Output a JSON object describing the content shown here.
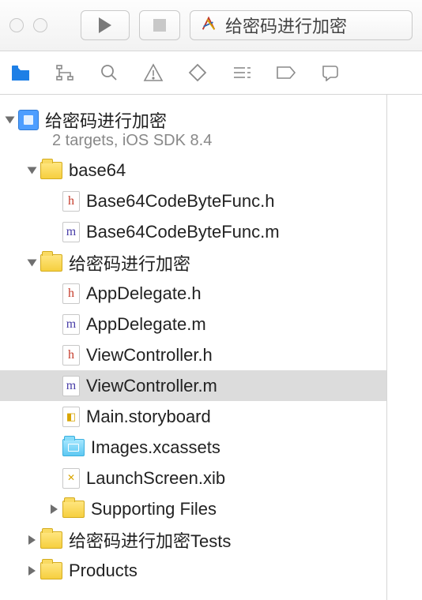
{
  "toolbar": {
    "scheme_label": "给密码进行加密"
  },
  "project": {
    "name": "给密码进行加密",
    "subtitle": "2 targets, iOS SDK 8.4"
  },
  "tree": [
    {
      "type": "folder",
      "name": "base64",
      "expanded": true,
      "depth": 1,
      "children": [
        {
          "type": "h",
          "name": "Base64CodeByteFunc.h",
          "depth": 2
        },
        {
          "type": "m",
          "name": "Base64CodeByteFunc.m",
          "depth": 2
        }
      ]
    },
    {
      "type": "folder",
      "name": "给密码进行加密",
      "expanded": true,
      "depth": 1,
      "children": [
        {
          "type": "h",
          "name": "AppDelegate.h",
          "depth": 2
        },
        {
          "type": "m",
          "name": "AppDelegate.m",
          "depth": 2
        },
        {
          "type": "h",
          "name": "ViewController.h",
          "depth": 2
        },
        {
          "type": "m",
          "name": "ViewController.m",
          "depth": 2,
          "selected": true
        },
        {
          "type": "sb",
          "name": "Main.storyboard",
          "depth": 2
        },
        {
          "type": "xcassets",
          "name": "Images.xcassets",
          "depth": 2
        },
        {
          "type": "xib",
          "name": "LaunchScreen.xib",
          "depth": 2
        },
        {
          "type": "folder",
          "name": "Supporting Files",
          "expanded": false,
          "depth": 2
        }
      ]
    },
    {
      "type": "folder",
      "name": "给密码进行加密Tests",
      "expanded": false,
      "depth": 1
    },
    {
      "type": "folder",
      "name": "Products",
      "expanded": false,
      "depth": 1
    }
  ]
}
